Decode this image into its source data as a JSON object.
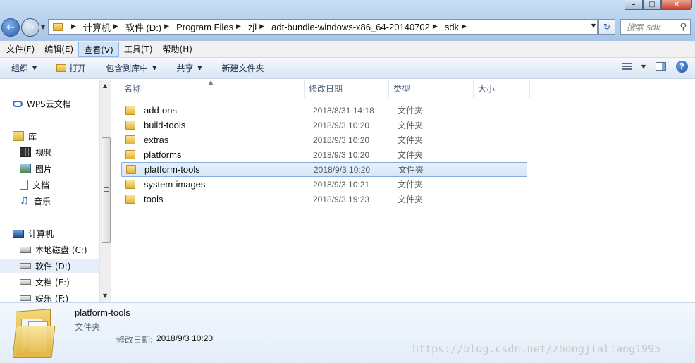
{
  "window": {
    "minimize_glyph": "–",
    "maximize_glyph": "□",
    "close_glyph": "✕"
  },
  "address": {
    "breadcrumbs": [
      "计算机",
      "软件 (D:)",
      "Program Files",
      "zjl",
      "adt-bundle-windows-x86_64-20140702",
      "sdk"
    ],
    "search_placeholder": "搜索 sdk"
  },
  "menu": [
    "文件(F)",
    "编辑(E)",
    "查看(V)",
    "工具(T)",
    "帮助(H)"
  ],
  "menu_active_index": 2,
  "toolbar": {
    "organize": "组织",
    "open": "打开",
    "include_in_library": "包含到库中",
    "share": "共享",
    "new_folder": "新建文件夹"
  },
  "nav": {
    "wps_cloud": "WPS云文档",
    "library": "库",
    "videos": "视频",
    "pictures": "图片",
    "documents": "文档",
    "music": "音乐",
    "computer": "计算机",
    "drive_c": "本地磁盘 (C:)",
    "drive_d": "软件 (D:)",
    "drive_e": "文档 (E:)",
    "drive_f": "娱乐 (F:)"
  },
  "columns": {
    "name": "名称",
    "date": "修改日期",
    "type": "类型",
    "size": "大小"
  },
  "files": [
    {
      "name": "add-ons",
      "date": "2018/8/31 14:18",
      "type": "文件夹"
    },
    {
      "name": "build-tools",
      "date": "2018/9/3 10:20",
      "type": "文件夹"
    },
    {
      "name": "extras",
      "date": "2018/9/3 10:20",
      "type": "文件夹"
    },
    {
      "name": "platforms",
      "date": "2018/9/3 10:20",
      "type": "文件夹"
    },
    {
      "name": "platform-tools",
      "date": "2018/9/3 10:20",
      "type": "文件夹"
    },
    {
      "name": "system-images",
      "date": "2018/9/3 10:21",
      "type": "文件夹"
    },
    {
      "name": "tools",
      "date": "2018/9/3 19:23",
      "type": "文件夹"
    }
  ],
  "selected_file_index": 4,
  "details": {
    "name": "platform-tools",
    "type": "文件夹",
    "modified_label": "修改日期:",
    "modified_value": "2018/9/3 10:20"
  },
  "watermark": "https://blog.csdn.net/zhongjialiang1995"
}
